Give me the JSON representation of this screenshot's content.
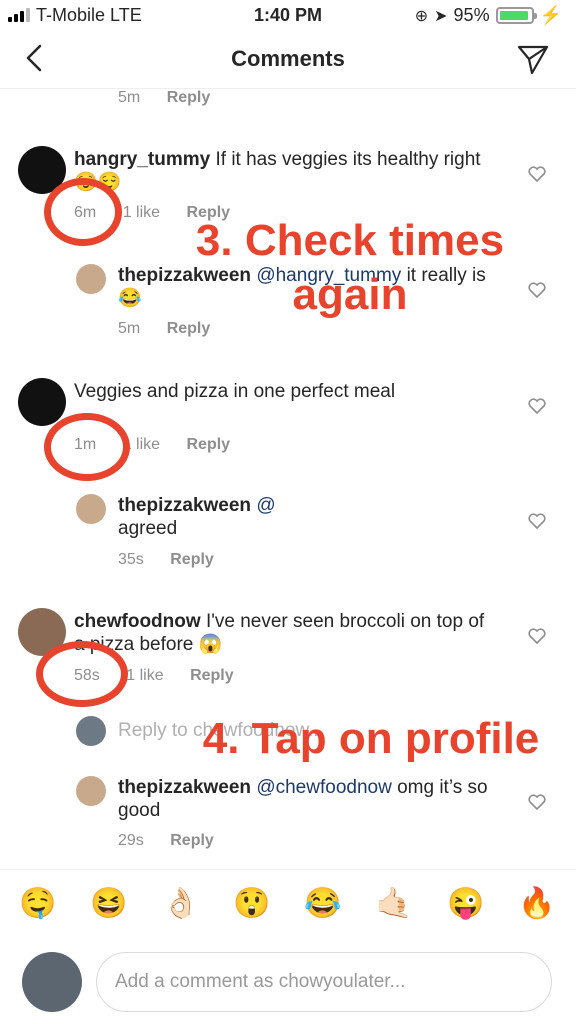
{
  "status": {
    "carrier": "T-Mobile  LTE",
    "time": "1:40 PM",
    "battery": "95%",
    "battery_level": 0.95
  },
  "header": {
    "title": "Comments"
  },
  "thread": {
    "top_meta": {
      "time": "5m",
      "reply": "Reply"
    },
    "c1": {
      "username": "hangry_tummy",
      "text": "If it has veggies its healthy right 😌😌",
      "time": "6m",
      "likes": "1 like",
      "reply": "Reply"
    },
    "r1": {
      "username": "thepizzakween",
      "mention": "@hangry_tummy",
      "text": "it really is 😂",
      "time": "5m",
      "reply": "Reply"
    },
    "c2": {
      "text": "Veggies and pizza in one perfect meal",
      "time": "1m",
      "likes": "1 like",
      "reply": "Reply"
    },
    "r2": {
      "username": "thepizzakween",
      "mention": "@",
      "text": "agreed",
      "time": "35s",
      "reply": "Reply"
    },
    "c3": {
      "username": "chewfoodnow",
      "text": "I've never seen broccoli on top of a pizza before 😱",
      "time": "58s",
      "likes": "1 like",
      "reply": "Reply"
    },
    "reply_to": "Reply to chewfoodnow...",
    "r3": {
      "username": "thepizzakween",
      "mention": "@chewfoodnow",
      "text": "omg it’s so good",
      "time": "29s",
      "reply": "Reply"
    }
  },
  "annotations": {
    "step3_line1": "3. Check times",
    "step3_line2": "again",
    "step4": "4. Tap on profile"
  },
  "emoji_bar": [
    "🤤",
    "😆",
    "👌🏻",
    "😲",
    "😂",
    "🤙🏻",
    "😜",
    "🔥"
  ],
  "composer": {
    "placeholder": "Add a comment as chowyoulater..."
  },
  "colors": {
    "annotation": "#e8432d",
    "mention": "#1c3a6b",
    "meta": "#8e8e8e"
  }
}
